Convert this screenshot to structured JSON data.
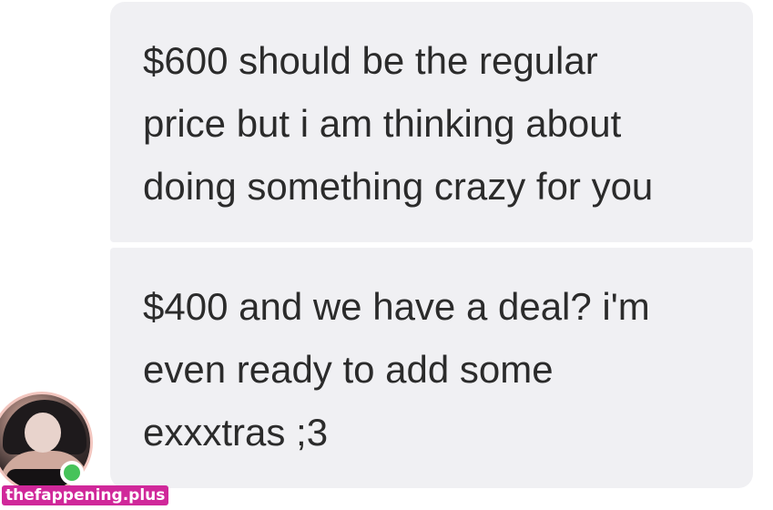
{
  "conversation": {
    "messages": [
      {
        "lines": [
          "$600 should be the regular",
          "price but i am thinking about",
          "doing something crazy for you"
        ]
      },
      {
        "lines": [
          "$400 and we have a deal? i'm",
          "even ready to add some",
          "exxxtras ;3"
        ]
      }
    ],
    "sender": {
      "status": "online",
      "status_color": "#46c35a"
    }
  },
  "watermark": {
    "text": "thefappening.plus",
    "color": "#d0289a"
  },
  "colors": {
    "bubble_bg": "#f0f0f3",
    "text": "#2b2b2b",
    "avatar_ring": "#f2c6bf"
  }
}
